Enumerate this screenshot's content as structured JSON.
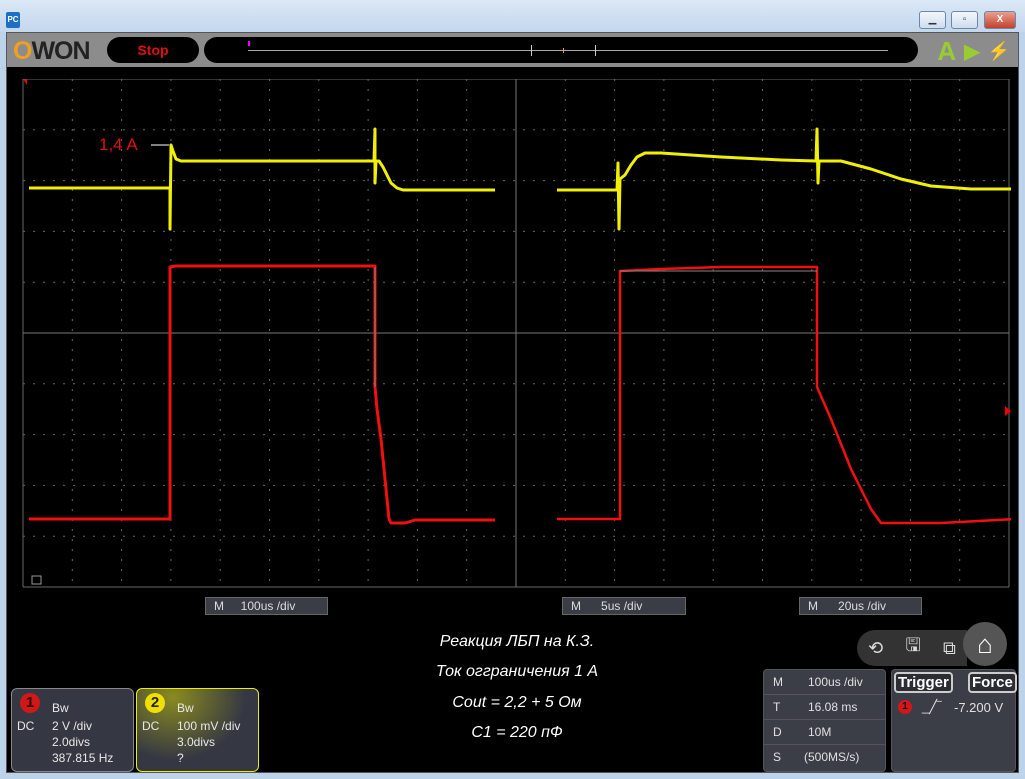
{
  "window": {
    "app_icon": "PC",
    "minimize": "▁",
    "maximize": "▫",
    "close": "X"
  },
  "toolbar": {
    "logo_o": "O",
    "logo_rest": "WON",
    "run_state": "Stop",
    "auto_icon": "A",
    "run_icon": "▶",
    "force_icon": "⚡"
  },
  "annotation": "1,4 A",
  "timebase_labels": [
    {
      "m": "M",
      "value": "100us /div"
    },
    {
      "m": "M",
      "value": "5us /div"
    },
    {
      "m": "M",
      "value": "20us /div"
    }
  ],
  "caption": [
    "Реакция ЛБП на К.З.",
    "Ток огграничения 1 А",
    "Cout = 2,2 + 5 Ом",
    "C1 = 220 пФ"
  ],
  "channels": [
    {
      "num": "1",
      "bw": "Bw",
      "coupling": "DC",
      "scale": "2 V /div",
      "offset": "2.0divs",
      "freq": "387.815 Hz",
      "color": "#e02020"
    },
    {
      "num": "2",
      "bw": "Bw",
      "coupling": "DC",
      "scale": "100 mV /div",
      "offset": "3.0divs",
      "freq": "?",
      "color": "#f0e000"
    }
  ],
  "horizontal": [
    {
      "k": "M",
      "v": "100us /div"
    },
    {
      "k": "T",
      "v": "16.08 ms"
    },
    {
      "k": "D",
      "v": "10M"
    },
    {
      "k": "S",
      "v": "(500MS/s)"
    }
  ],
  "trigger": {
    "label": "Trigger",
    "force": "Force",
    "source": "1",
    "slope": "rising",
    "level": "-7.200 V"
  },
  "markers": {
    "ch1": "1",
    "ch2": "2"
  },
  "icons": [
    "auto-icon",
    "run-icon",
    "force-trigger-icon",
    "undo-home-icon",
    "save-icon",
    "window-switch-icon",
    "home-icon"
  ]
}
